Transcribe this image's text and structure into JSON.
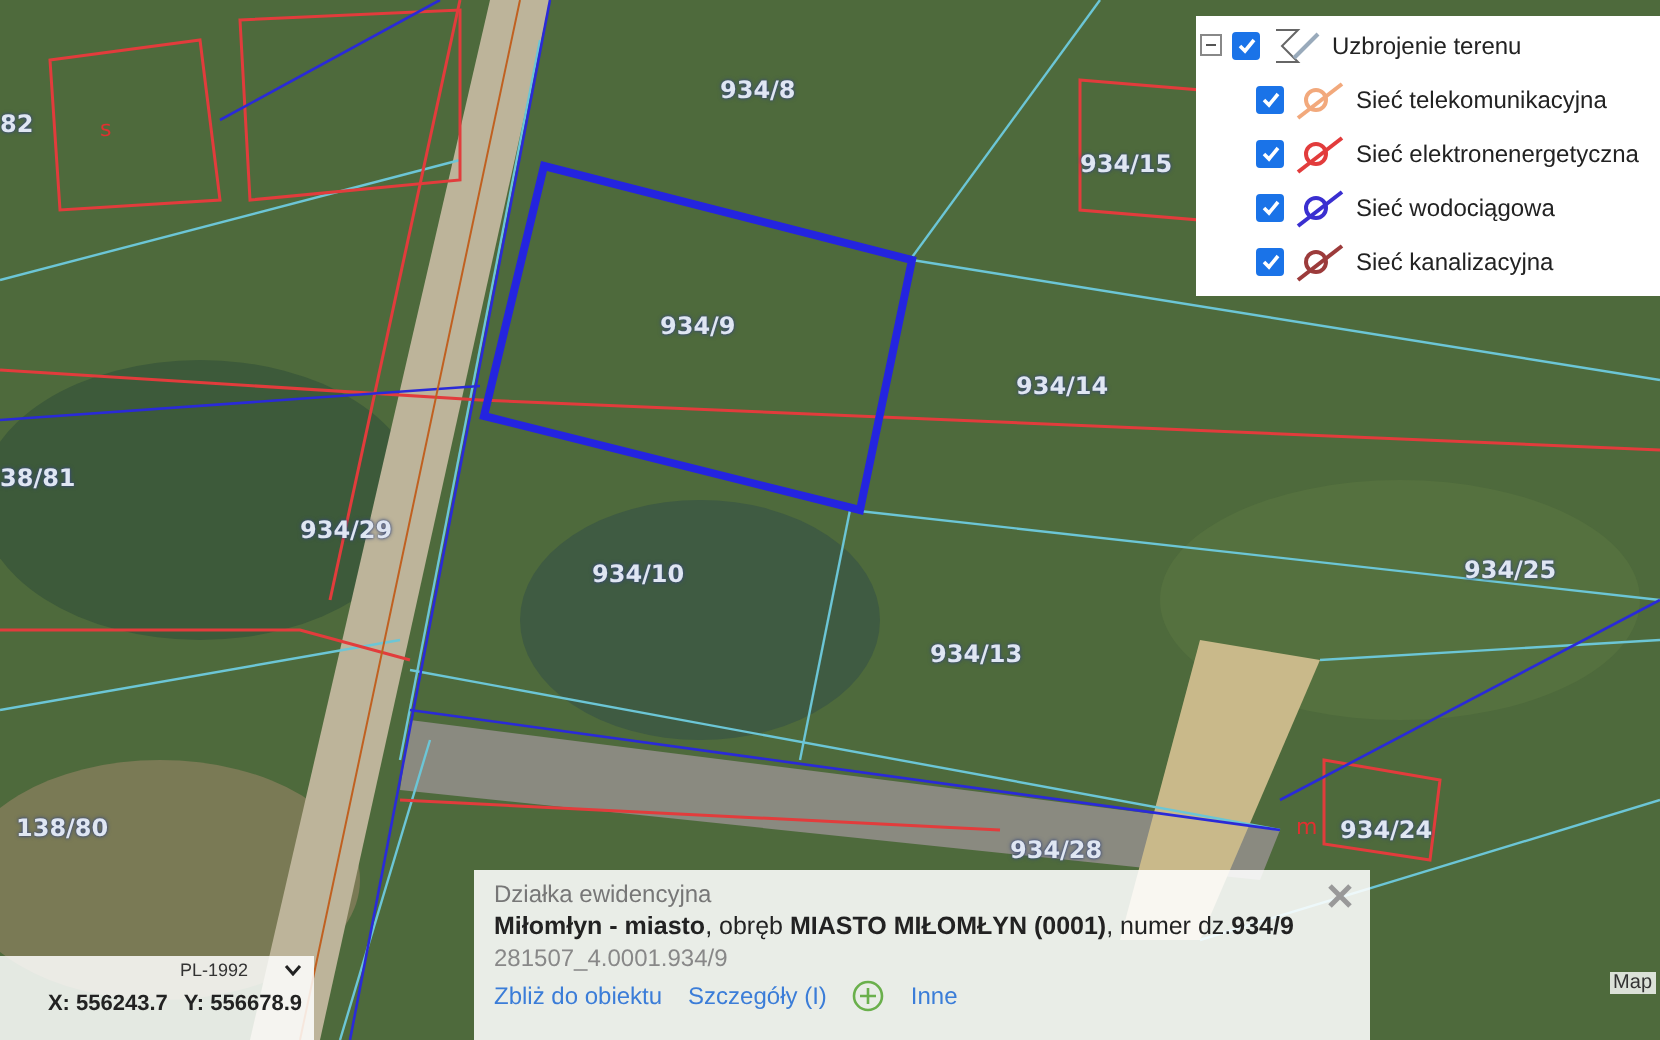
{
  "map": {
    "parcel_labels": [
      {
        "text": "934/8"
      },
      {
        "text": "82"
      },
      {
        "text": "934/15"
      },
      {
        "text": "934/9"
      },
      {
        "text": "934/14"
      },
      {
        "text": "38/81"
      },
      {
        "text": "934/29"
      },
      {
        "text": "934/10"
      },
      {
        "text": "934/13"
      },
      {
        "text": "934/25"
      },
      {
        "text": "138/80"
      },
      {
        "text": "934/24"
      },
      {
        "text": "934/28"
      }
    ],
    "building_marks": [
      {
        "text": "s"
      },
      {
        "text": "m"
      }
    ]
  },
  "legend": {
    "expanded": true,
    "checked": true,
    "label": "Uzbrojenie terenu",
    "layers": [
      {
        "label": "Sieć telekomunikacyjna",
        "checked": true,
        "color": "#f2a97c"
      },
      {
        "label": "Sieć elektronenergetyczna",
        "checked": true,
        "color": "#e23c3c"
      },
      {
        "label": "Sieć wodociągowa",
        "checked": true,
        "color": "#3a2fd0"
      },
      {
        "label": "Sieć kanalizacyjna",
        "checked": true,
        "color": "#9c3b3b"
      }
    ]
  },
  "popup": {
    "title": "Działka ewidencyjna",
    "description": "**Miłomłyn - miasto**, obręb **MIASTO MIŁOMŁYN (0001)**, numer dz.**934/9**",
    "identifier": "281507_4.0001.934/9",
    "links": [
      "Zbliż do obiektu",
      "Szczegóły (I)"
    ],
    "more_link": "Inne"
  },
  "coordinates": {
    "crs": "PL-1992",
    "x": "X: 556243.7",
    "y": "Y: 556678.9"
  },
  "attribution": "Map"
}
